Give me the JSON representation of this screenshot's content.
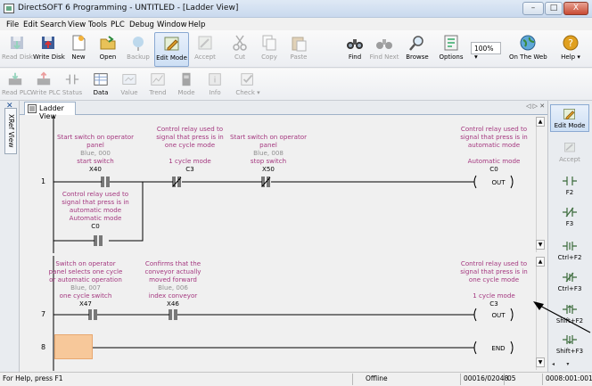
{
  "window": {
    "title": "DirectSOFT 6 Programming - UNTITLED - [Ladder View]",
    "min": "–",
    "max": "□",
    "close": "X"
  },
  "menu": [
    "File",
    "Edit",
    "Search",
    "View",
    "Tools",
    "PLC",
    "Debug",
    "Window",
    "Help"
  ],
  "toolbar1": {
    "read_disk": "Read Disk",
    "write_disk": "Write Disk",
    "new": "New",
    "open": "Open",
    "backup": "Backup",
    "edit_mode": "Edit Mode",
    "accept": "Accept",
    "cut": "Cut",
    "copy": "Copy",
    "paste": "Paste",
    "find": "Find",
    "find_next": "Find Next",
    "browse": "Browse",
    "options": "Options",
    "zoom": "100%",
    "on_the_web": "On The Web",
    "help": "Help"
  },
  "toolbar2": {
    "read_plc": "Read PLC",
    "write_plc": "Write PLC",
    "status": "Status",
    "data": "Data",
    "value": "Value",
    "trend": "Trend",
    "mode": "Mode",
    "info": "Info",
    "check": "Check"
  },
  "sidebar": {
    "xref": "XRef View"
  },
  "doc_tab": {
    "label": "Ladder View"
  },
  "pane1": {
    "rung1": {
      "number": "1",
      "x40": {
        "cmt1": "Start switch on operator",
        "cmt2": "panel",
        "blue": "Blue, 000",
        "tag": "start switch",
        "addr": "X40"
      },
      "c3": {
        "cmt1": "Control relay used to",
        "cmt2": "signal that press is in",
        "cmt3": "one cycle mode",
        "tag": "1 cycle mode",
        "addr": "C3"
      },
      "x50": {
        "cmt1": "Start switch on operator",
        "cmt2": "panel",
        "blue": "Blue, 008",
        "tag": "stop switch",
        "addr": "X50"
      },
      "out": {
        "cmt1": "Control relay used to",
        "cmt2": "signal that press is in",
        "cmt3": "automatic mode",
        "tag": "Automatic mode",
        "addr": "C0",
        "label": "OUT"
      },
      "branch": {
        "cmt1": "Control relay used to",
        "cmt2": "signal that press is in",
        "cmt3": "automatic mode",
        "tag": "Automatic mode",
        "addr": "C0"
      }
    }
  },
  "pane2": {
    "rung7": {
      "number": "7",
      "x47": {
        "cmt1": "Switch on operator",
        "cmt2": "panel selects one cycle",
        "cmt3": "or automatic operation",
        "blue": "Blue, 007",
        "tag": "one cycle switch",
        "addr": "X47"
      },
      "x46": {
        "cmt1": "Confirms that the",
        "cmt2": "conveyor actually",
        "cmt3": "moved forward",
        "blue": "Blue, 006",
        "tag": "index conveyor",
        "addr": "X46"
      },
      "out": {
        "cmt1": "Control relay used to",
        "cmt2": "signal that press is in",
        "cmt3": "one cycle mode",
        "tag": "1 cycle mode",
        "addr": "C3",
        "label": "OUT"
      }
    },
    "rung8": {
      "number": "8",
      "end": "END"
    }
  },
  "rightbar": {
    "edit_mode": "Edit Mode",
    "accept": "Accept",
    "f2": "F2",
    "f3": "F3",
    "ctrl_f2": "Ctrl+F2",
    "ctrl_f3": "Ctrl+F3",
    "shift_f2": "Shift+F2",
    "shift_f3": "Shift+F3"
  },
  "statusbar": {
    "help": "For Help, press F1",
    "mode": "Offline",
    "count": "00016/02048",
    "num": "05",
    "addr": "0008:001:001"
  }
}
